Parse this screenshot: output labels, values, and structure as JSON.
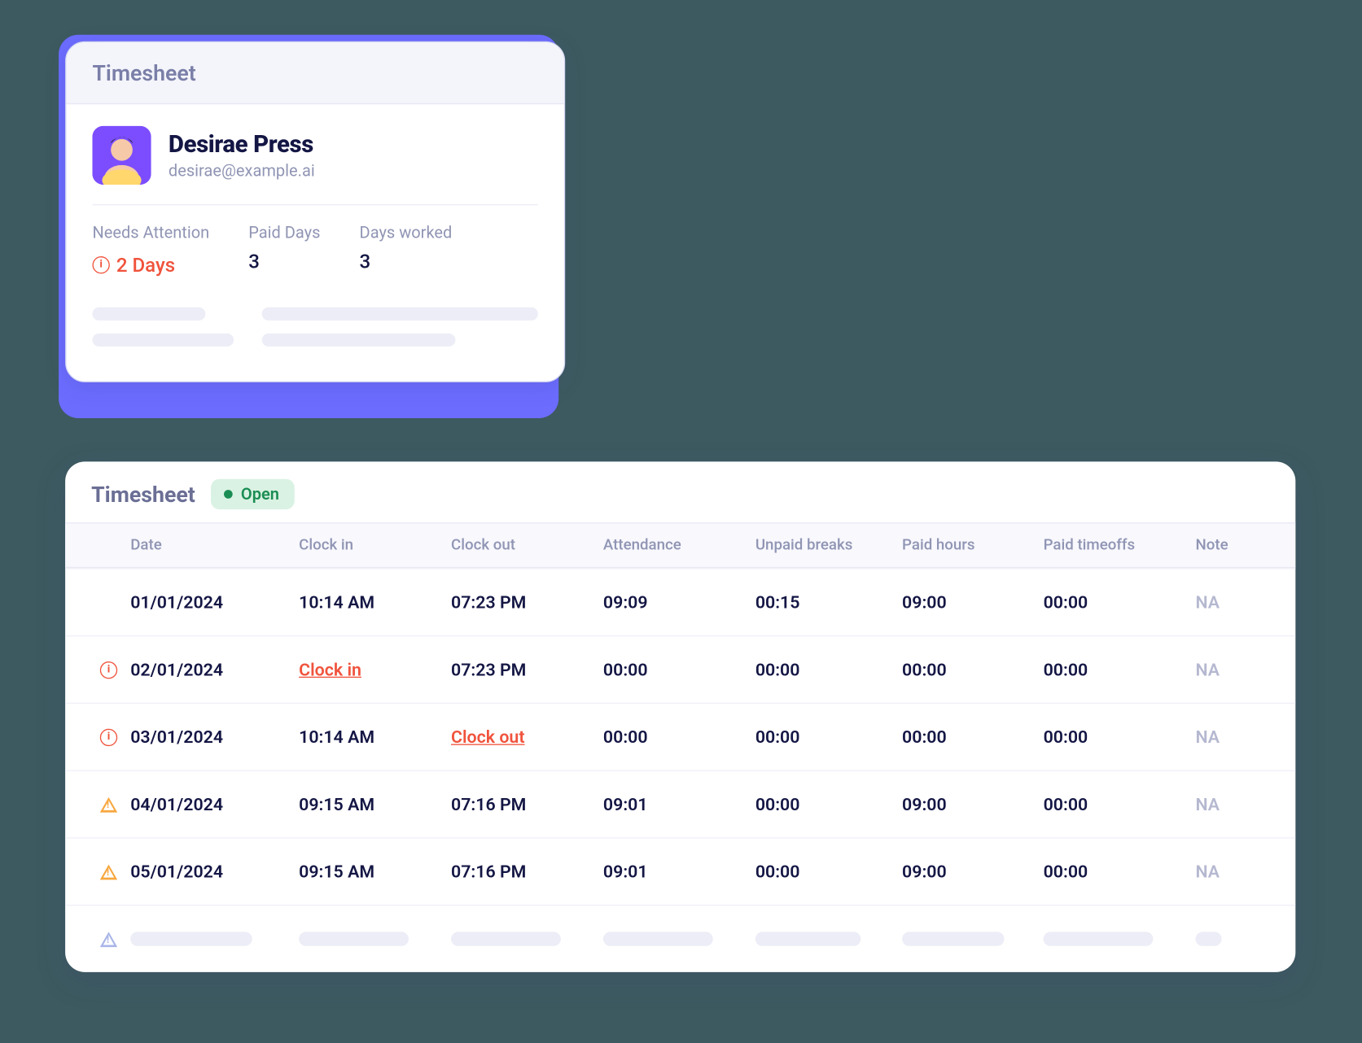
{
  "summary": {
    "title": "Timesheet",
    "user": {
      "name": "Desirae Press",
      "email": "desirae@example.ai"
    },
    "stats": {
      "needs_attention": {
        "label": "Needs Attention",
        "value": "2 Days"
      },
      "paid_days": {
        "label": "Paid Days",
        "value": "3"
      },
      "days_worked": {
        "label": "Days worked",
        "value": "3"
      }
    }
  },
  "table": {
    "title": "Timesheet",
    "status": "Open",
    "columns": {
      "date": "Date",
      "clock_in": "Clock in",
      "clock_out": "Clock out",
      "attendance": "Attendance",
      "unpaid_breaks": "Unpaid breaks",
      "paid_hours": "Paid hours",
      "paid_timeoffs": "Paid timeoffs",
      "note": "Note"
    },
    "rows": [
      {
        "icon": "none",
        "date": "01/01/2024",
        "clock_in": "10:14 AM",
        "clock_in_link": false,
        "clock_out": "07:23 PM",
        "clock_out_link": false,
        "attendance": "09:09",
        "unpaid_breaks": "00:15",
        "paid_hours": "09:00",
        "paid_timeoffs": "00:00",
        "note": "NA"
      },
      {
        "icon": "alert",
        "date": "02/01/2024",
        "clock_in": "Clock in",
        "clock_in_link": true,
        "clock_out": "07:23 PM",
        "clock_out_link": false,
        "attendance": "00:00",
        "unpaid_breaks": "00:00",
        "paid_hours": "00:00",
        "paid_timeoffs": "00:00",
        "note": "NA"
      },
      {
        "icon": "alert",
        "date": "03/01/2024",
        "clock_in": "10:14 AM",
        "clock_in_link": false,
        "clock_out": "Clock out",
        "clock_out_link": true,
        "attendance": "00:00",
        "unpaid_breaks": "00:00",
        "paid_hours": "00:00",
        "paid_timeoffs": "00:00",
        "note": "NA"
      },
      {
        "icon": "warn",
        "date": "04/01/2024",
        "clock_in": "09:15 AM",
        "clock_in_link": false,
        "clock_out": "07:16 PM",
        "clock_out_link": false,
        "attendance": "09:01",
        "unpaid_breaks": "00:00",
        "paid_hours": "09:00",
        "paid_timeoffs": "00:00",
        "note": "NA"
      },
      {
        "icon": "warn",
        "date": "05/01/2024",
        "clock_in": "09:15 AM",
        "clock_in_link": false,
        "clock_out": "07:16 PM",
        "clock_out_link": false,
        "attendance": "09:01",
        "unpaid_breaks": "00:00",
        "paid_hours": "09:00",
        "paid_timeoffs": "00:00",
        "note": "NA"
      }
    ]
  }
}
